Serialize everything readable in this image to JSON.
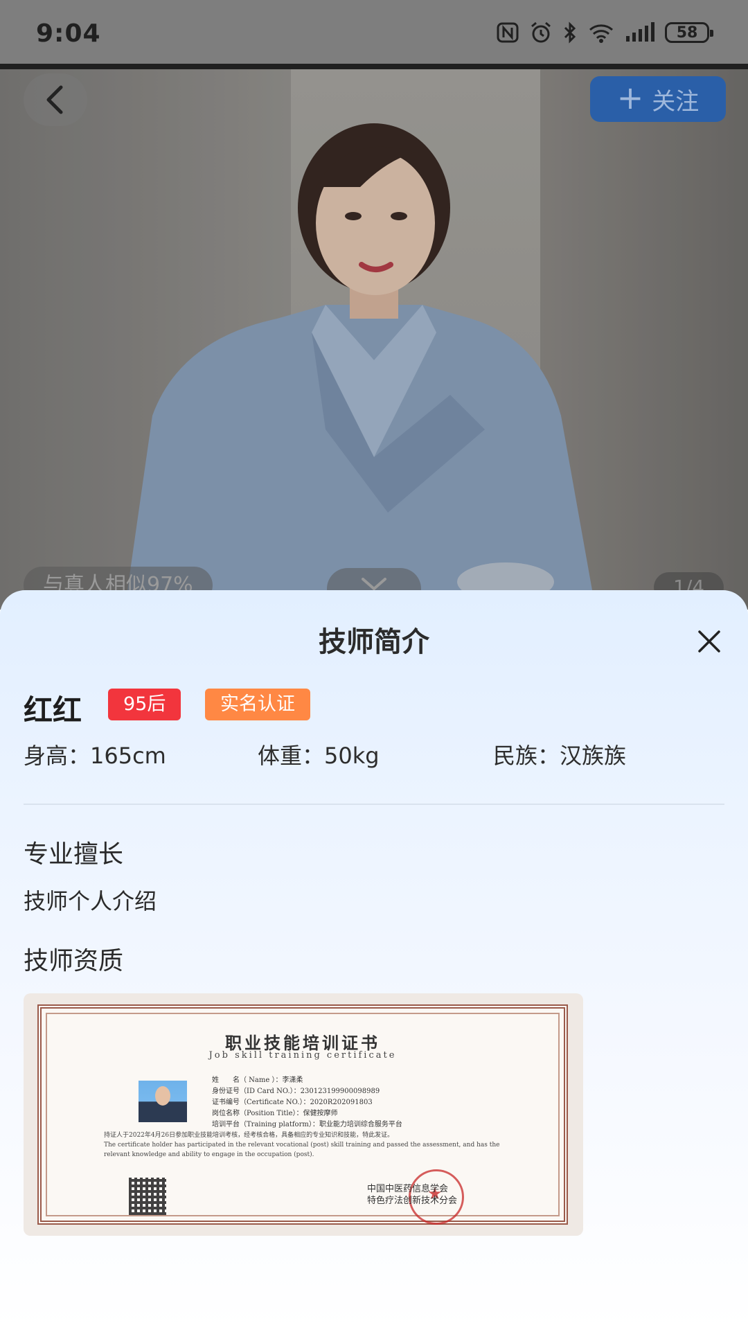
{
  "status_bar": {
    "time": "9:04",
    "battery": "58"
  },
  "header": {
    "follow_label": "关注"
  },
  "gallery": {
    "similarity": "与真人相似97%",
    "page_indicator": "1/4"
  },
  "sheet": {
    "title": "技师简介",
    "name": "红红",
    "tags": [
      "95后",
      "实名认证"
    ],
    "info": {
      "height": "身高：165cm",
      "weight": "体重：50kg",
      "ethnicity": "民族：汉族族"
    },
    "specialty_heading": "专业擅长",
    "specialty_text": "技师个人介绍",
    "qualification_heading": "技师资质",
    "certificate": {
      "title": "职业技能培训证书",
      "subtitle": "Job skill training certificate",
      "name_line": "姓　　名（ Name ）：李潇柔",
      "id_line": "身份证号（ID Card NO.）：230123199900098989",
      "cert_no_line": "证书编号（Certificate NO.）：2020R202091803",
      "position_line": "岗位名称（Position Title）：保健按摩师",
      "platform_line": "培训平台（Training platform）：职业能力培训综合服务平台",
      "body_cn": "持证人于2022年4月26日参加职业技能培训考核，经考核合格，具备相应的专业知识和技能，特此发证。",
      "body_en": "The certificate holder has participated in the relevant vocational (post) skill training and passed the assessment, and has the relevant knowledge and ability to engage in the occupation (post).",
      "issuer_1": "中国中医药信息学会",
      "issuer_2": "特色疗法创新技术分会"
    }
  }
}
